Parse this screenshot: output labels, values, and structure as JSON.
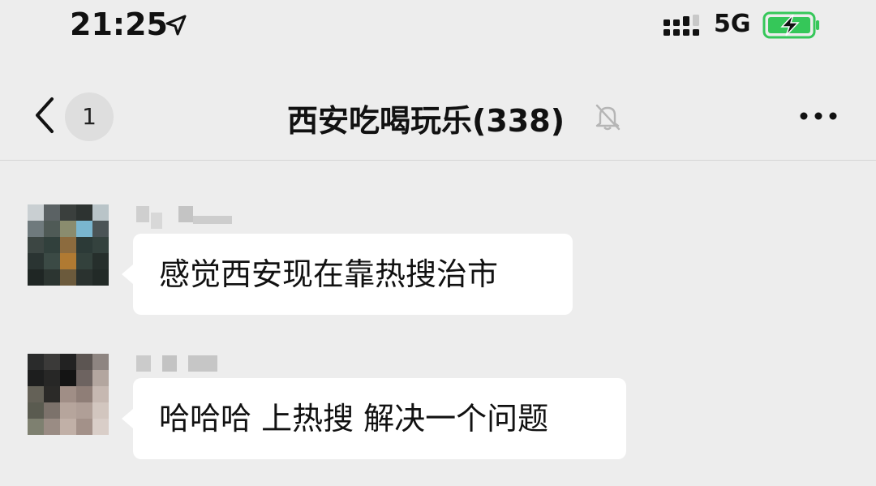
{
  "status_bar": {
    "time": "21:25",
    "network": "5G",
    "icons": [
      "location-arrow-icon",
      "signal-icon",
      "battery-charging-icon"
    ],
    "battery_color": "#35c759"
  },
  "nav": {
    "back_icon": "chevron-left-icon",
    "unread_count": "1",
    "title": "西安吃喝玩乐(338)",
    "mute_icon": "bell-muted-icon",
    "more_icon": "more-dots-icon"
  },
  "messages": [
    {
      "text": "感觉西安现在靠热搜治市"
    },
    {
      "text": "哈哈哈 上热搜 解决一个问题"
    }
  ],
  "colors": {
    "background": "#ededed",
    "bubble": "#ffffff",
    "badge": "#dedede"
  }
}
